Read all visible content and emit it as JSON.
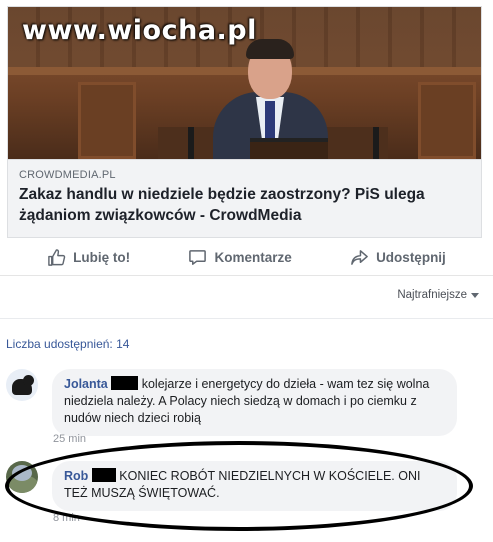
{
  "watermark": "www.wiocha.pl",
  "link": {
    "domain": "CROWDMEDIA.PL",
    "title": "Zakaz handlu w niedziele będzie zaostrzony? PiS ulega żądaniom związkowców - CrowdMedia"
  },
  "actions": {
    "like": "Lubię to!",
    "comment": "Komentarze",
    "share": "Udostępnij"
  },
  "icons": {
    "like": "thumbs-up-icon",
    "comment": "speech-bubble-icon",
    "share": "share-arrow-icon"
  },
  "sort": {
    "label": "Najtrafniejsze"
  },
  "shares": {
    "label": "Liczba udostępnień: 14"
  },
  "comments": [
    {
      "author": "Jolanta",
      "text": " kolejarze i energetycy do dzieła - wam tez się wolna niedziela należy. A Polacy niech siedzą w domach i po ciemku z nudów niech dzieci robią",
      "time": "25 min"
    },
    {
      "author": "Rob",
      "text": " KONIEC ROBÓT NIEDZIELNYCH W KOŚCIELE. ONI TEŻ MUSZĄ ŚWIĘTOWAĆ.",
      "time": "8 min"
    }
  ],
  "colors": {
    "link_blue": "#385898",
    "action_gray": "#606770",
    "bubble_bg": "#f2f3f5"
  }
}
